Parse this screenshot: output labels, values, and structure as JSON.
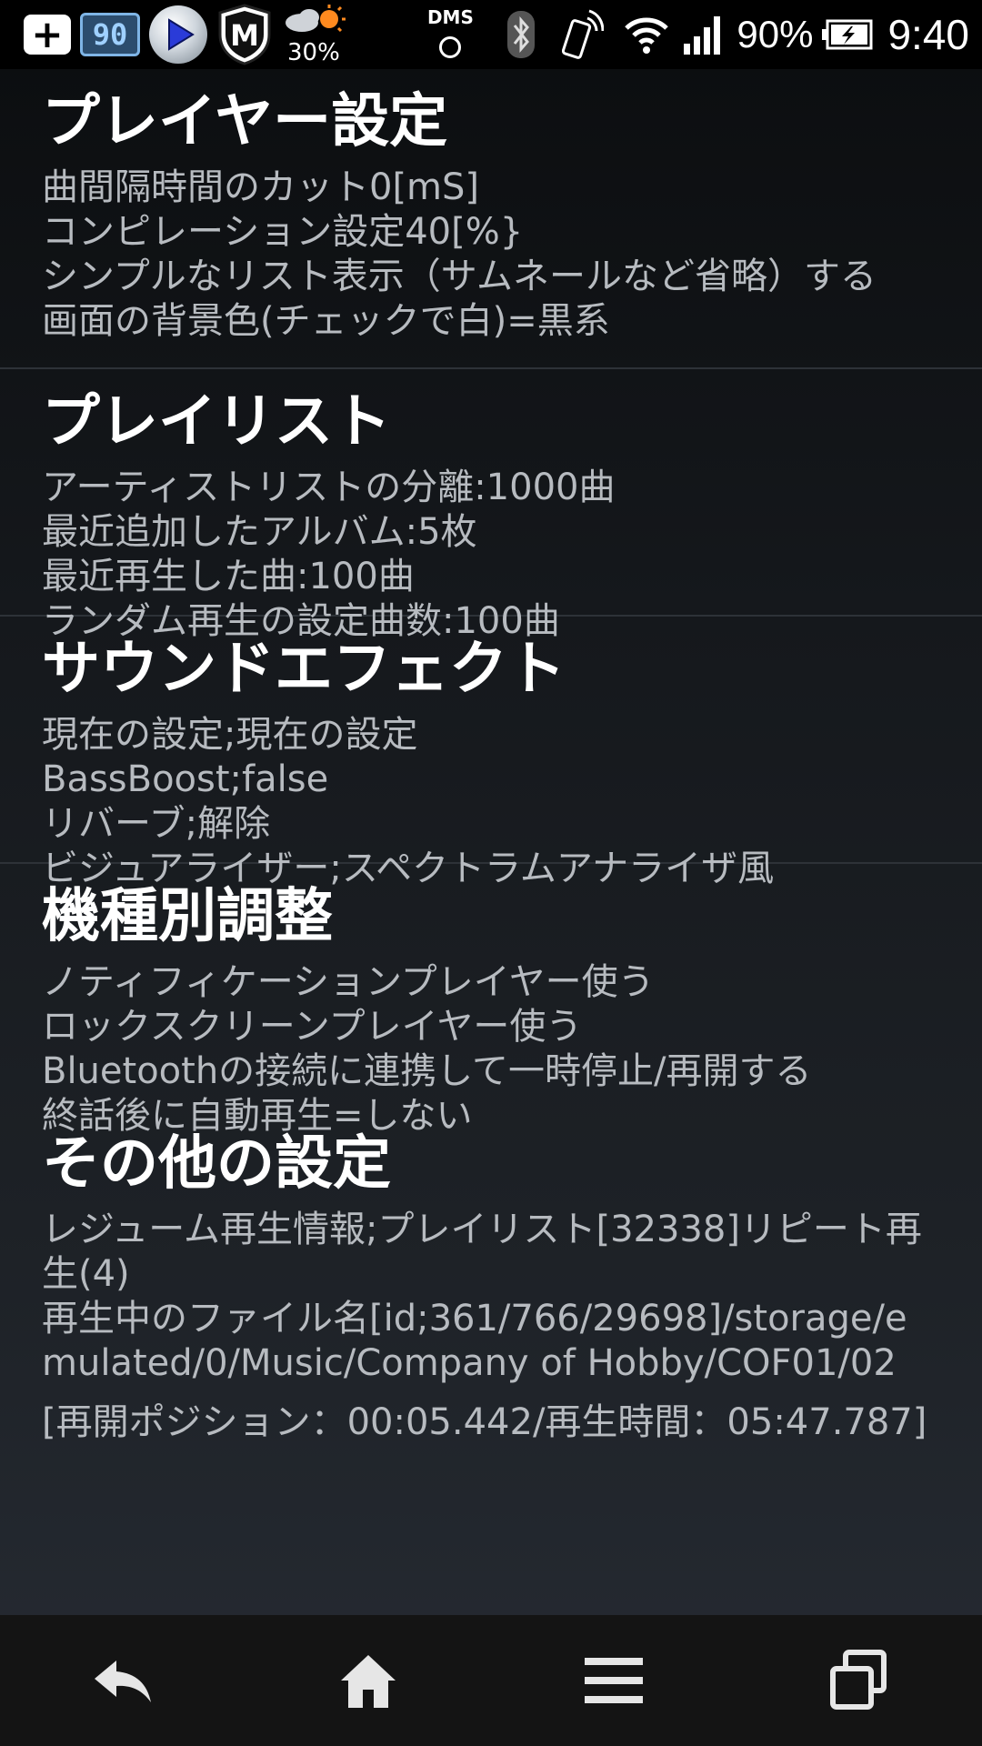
{
  "status_bar": {
    "left_icons": [
      "add-icon",
      "battery-app-icon",
      "media-player-icon",
      "mcafee-shield-icon",
      "weather-icon"
    ],
    "battery_widget_text": "90",
    "weather_percent": "30%",
    "dms_label": "DMS",
    "battery_percent": "90%",
    "time": "9:40"
  },
  "sections": [
    {
      "title": "プレイヤー設定",
      "lines": [
        "曲間隔時間のカット0[mS]",
        "コンピレーション設定40[%}",
        "シンプルなリスト表示（サムネールなど省略）する",
        "画面の背景色(チェックで白)=黒系"
      ]
    },
    {
      "title": "プレイリスト",
      "lines": [
        "アーティストリストの分離:1000曲",
        "最近追加したアルバム:5枚",
        "最近再生した曲:100曲",
        "ランダム再生の設定曲数:100曲"
      ]
    },
    {
      "title": "サウンドエフェクト",
      "lines": [
        "現在の設定;現在の設定",
        "BassBoost;false",
        "リバーブ;解除",
        "ビジュアライザー;スペクトラムアナライザ風"
      ]
    },
    {
      "title": "機種別調整",
      "lines": [
        "ノティフィケーションプレイヤー使う",
        "ロックスクリーンプレイヤー使う",
        "Bluetoothの接続に連携して一時停止/再開する",
        "終話後に自動再生=しない"
      ]
    },
    {
      "title": "その他の設定",
      "lines": [
        "レジューム再生情報;プレイリスト[32338]リピート再生(4)",
        "再生中のファイル名[id;361/766/29698]/storage/emulated/0/Music/Company of Hobby/COF01/02"
      ],
      "cut_line": "[再開ポジション：00:05.442/再生時間：05:47.787]"
    }
  ],
  "nav_bar": {
    "buttons": [
      "back-icon",
      "home-icon",
      "menu-icon",
      "recent-apps-icon"
    ]
  }
}
